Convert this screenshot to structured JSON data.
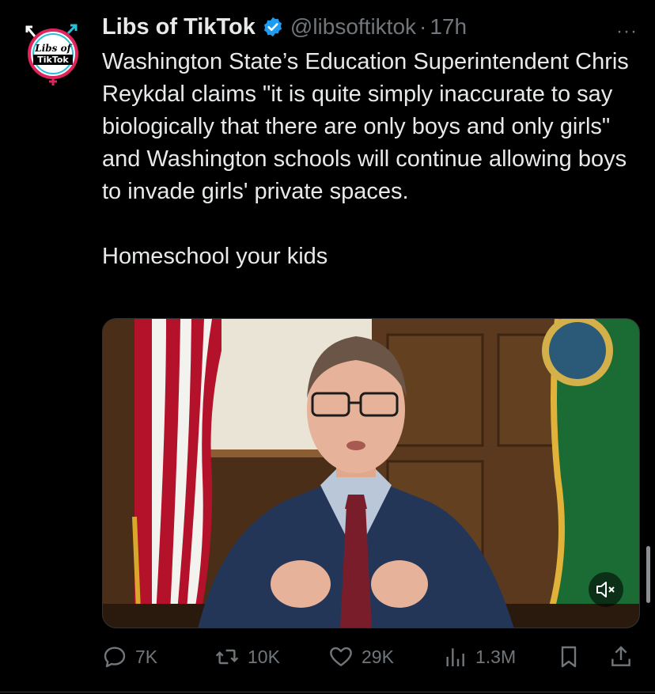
{
  "tweet": {
    "author_name": "Libs of TikTok",
    "handle": "@libsoftiktok",
    "separator": "·",
    "time": "17h",
    "more_label": "···",
    "avatar_text_line1": "Libs of",
    "avatar_text_line2": "TikTok",
    "text_paragraph_1": "Washington State’s Education Superintendent Chris Reykdal claims \"it is quite simply inaccurate to say biologically that there are only boys and only girls\" and Washington schools will continue allowing boys to invade girls' private spaces.",
    "text_paragraph_2": "Homeschool your kids"
  },
  "media": {
    "type": "video",
    "muted": true,
    "mute_icon": "speaker-muted-icon"
  },
  "actions": {
    "replies": "7K",
    "retweets": "10K",
    "likes": "29K",
    "views": "1.3M"
  },
  "colors": {
    "background": "#000000",
    "text": "#e7e9ea",
    "secondary": "#71767b",
    "verified": "#1d9bf0",
    "avatar_ring_pink": "#e0245e",
    "avatar_ring_cyan": "#27c0d8"
  }
}
